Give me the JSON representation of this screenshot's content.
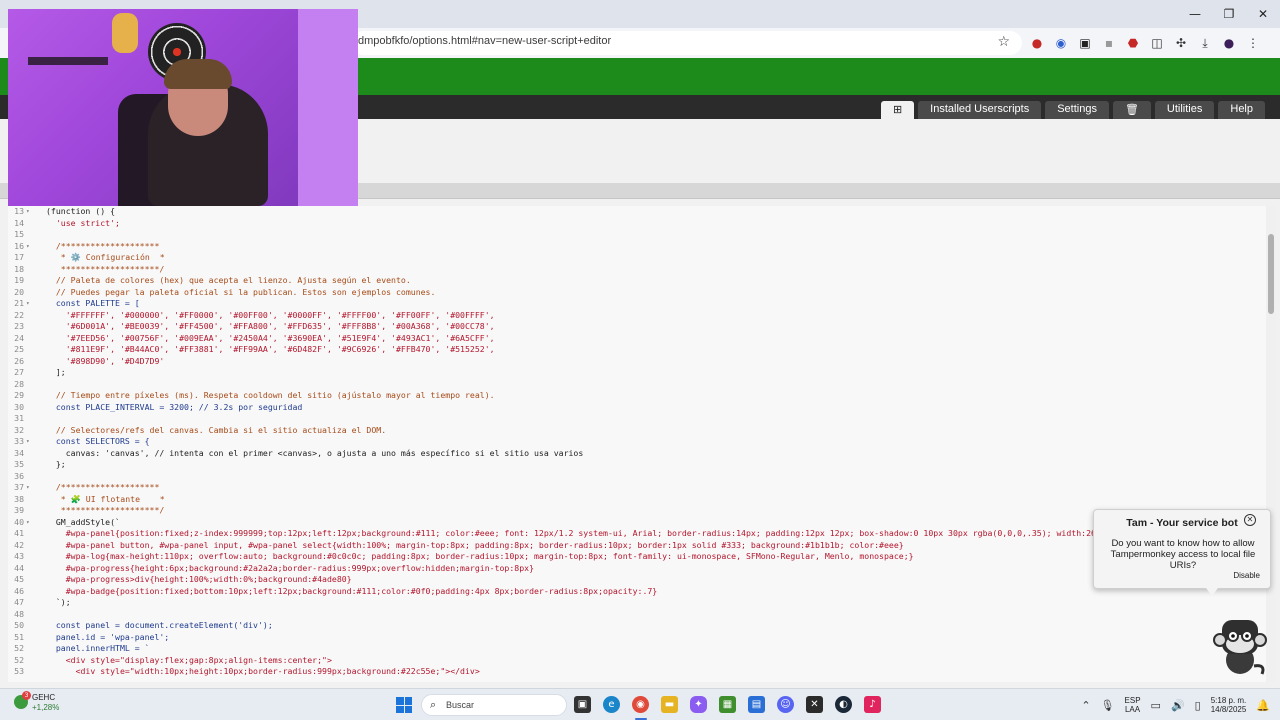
{
  "browser": {
    "url": "dmpobfkfo/options.html#nav=new-user-script+editor",
    "window_controls": [
      "—",
      "❐",
      "✕"
    ]
  },
  "tampermonkey": {
    "tabs": [
      "Installed Userscripts",
      "Settings",
      "Utilities",
      "Help"
    ]
  },
  "editor": {
    "lines": [
      {
        "n": "13",
        "fold": true,
        "text": "(function () {",
        "kind": "code"
      },
      {
        "n": "14",
        "text": "  'use strict';",
        "kind": "red"
      },
      {
        "n": "15",
        "text": "",
        "kind": "code"
      },
      {
        "n": "16",
        "fold": true,
        "text": "  /********************",
        "kind": "comment"
      },
      {
        "n": "17",
        "text": "   * ⚙️ Configuración  *",
        "kind": "comment"
      },
      {
        "n": "18",
        "text": "   ********************/",
        "kind": "comment"
      },
      {
        "n": "19",
        "text": "  // Paleta de colores (hex) que acepta el lienzo. Ajusta según el evento.",
        "kind": "comment"
      },
      {
        "n": "20",
        "text": "  // Puedes pegar la paleta oficial si la publican. Estos son ejemplos comunes.",
        "kind": "comment"
      },
      {
        "n": "21",
        "fold": true,
        "text": "  const PALETTE = [",
        "kind": "blue"
      },
      {
        "n": "22",
        "text": "    '#FFFFFF', '#000000', '#FF0000', '#00FF00', '#0000FF', '#FFFF00', '#FF00FF', '#00FFFF',",
        "kind": "red"
      },
      {
        "n": "23",
        "text": "    '#6D001A', '#BE0039', '#FF4500', '#FFA800', '#FFD635', '#FFF8B8', '#00A368', '#00CC78',",
        "kind": "red"
      },
      {
        "n": "24",
        "text": "    '#7EED56', '#00756F', '#009EAA', '#2450A4', '#3690EA', '#51E9F4', '#493AC1', '#6A5CFF',",
        "kind": "red"
      },
      {
        "n": "25",
        "text": "    '#811E9F', '#B44AC0', '#FF3881', '#FF99AA', '#6D482F', '#9C6926', '#FFB470', '#515252',",
        "kind": "red"
      },
      {
        "n": "26",
        "text": "    '#898D90', '#D4D7D9'",
        "kind": "red"
      },
      {
        "n": "27",
        "text": "  ];",
        "kind": "code"
      },
      {
        "n": "28",
        "text": "",
        "kind": "code"
      },
      {
        "n": "29",
        "text": "  // Tiempo entre píxeles (ms). Respeta cooldown del sitio (ajústalo mayor al tiempo real).",
        "kind": "comment"
      },
      {
        "n": "30",
        "text": "  const PLACE_INTERVAL = 3200; // 3.2s por seguridad",
        "kind": "blue"
      },
      {
        "n": "31",
        "text": "",
        "kind": "code"
      },
      {
        "n": "32",
        "text": "  // Selectores/refs del canvas. Cambia si el sitio actualiza el DOM.",
        "kind": "comment"
      },
      {
        "n": "33",
        "fold": true,
        "text": "  const SELECTORS = {",
        "kind": "blue"
      },
      {
        "n": "34",
        "text": "    canvas: 'canvas', // intenta con el primer <canvas>, o ajusta a uno más específico si el sitio usa varios",
        "kind": "code"
      },
      {
        "n": "35",
        "text": "  };",
        "kind": "code"
      },
      {
        "n": "36",
        "text": "",
        "kind": "code"
      },
      {
        "n": "37",
        "fold": true,
        "text": "  /********************",
        "kind": "comment"
      },
      {
        "n": "38",
        "text": "   * 🧩 UI flotante    *",
        "kind": "comment"
      },
      {
        "n": "39",
        "text": "   ********************/",
        "kind": "comment"
      },
      {
        "n": "40",
        "fold": true,
        "text": "  GM_addStyle(`",
        "kind": "code"
      },
      {
        "n": "41",
        "text": "    #wpa-panel{position:fixed;z-index:999999;top:12px;left:12px;background:#111; color:#eee; font: 12px/1.2 system-ui, Arial; border-radius:14px; padding:12px 12px; box-shadow:0 10px 30px rgba(0,0,0,.35); width:260px;}",
        "kind": "red"
      },
      {
        "n": "42",
        "text": "    #wpa-panel button, #wpa-panel input, #wpa-panel select{width:100%; margin-top:8px; padding:8px; border-radius:10px; border:1px solid #333; background:#1b1b1b; color:#eee}",
        "kind": "red"
      },
      {
        "n": "43",
        "text": "    #wpa-log{max-height:110px; overflow:auto; background:#0c0c0c; padding:8px; border-radius:10px; margin-top:8px; font-family: ui-monospace, SFMono-Regular, Menlo, monospace;}",
        "kind": "red"
      },
      {
        "n": "44",
        "text": "    #wpa-progress{height:6px;background:#2a2a2a;border-radius:999px;overflow:hidden;margin-top:8px}",
        "kind": "red"
      },
      {
        "n": "45",
        "text": "    #wpa-progress>div{height:100%;width:0%;background:#4ade80}",
        "kind": "red"
      },
      {
        "n": "46",
        "text": "    #wpa-badge{position:fixed;bottom:10px;left:12px;background:#111;color:#0f0;padding:4px 8px;border-radius:8px;opacity:.7}",
        "kind": "red"
      },
      {
        "n": "47",
        "text": "  `);",
        "kind": "code"
      },
      {
        "n": "48",
        "text": "",
        "kind": "code"
      },
      {
        "n": "50",
        "text": "  const panel = document.createElement('div');",
        "kind": "blue"
      },
      {
        "n": "51",
        "text": "  panel.id = 'wpa-panel';",
        "kind": "blue"
      },
      {
        "n": "52",
        "text": "  panel.innerHTML = `",
        "kind": "blue"
      },
      {
        "n": "52",
        "text": "    <div style=\"display:flex;gap:8px;align-items:center;\">",
        "kind": "red"
      },
      {
        "n": "53",
        "text": "      <div style=\"width:10px;height:10px;border-radius:999px;background:#22c55e;\"></div>",
        "kind": "red"
      }
    ]
  },
  "bot": {
    "title": "Tam - Your service bot",
    "message": "Do you want to know how to allow Tampermonkey access to local file URIs?",
    "disable": "Disable"
  },
  "taskbar": {
    "weather_badge": "3",
    "weather_name": "GEHC",
    "weather_change": "+1,28%",
    "search_placeholder": "Buscar",
    "lang_top": "ESP",
    "lang_bottom": "LAA",
    "time": "5:18 p. m.",
    "date": "14/8/2025"
  },
  "colors": {
    "tampermonkey_green": "#1c8b1c",
    "nav_dark": "#2b2b2b",
    "comment": "#a64c1a",
    "string": "#b3172e",
    "keyword": "#1f3b8f"
  }
}
